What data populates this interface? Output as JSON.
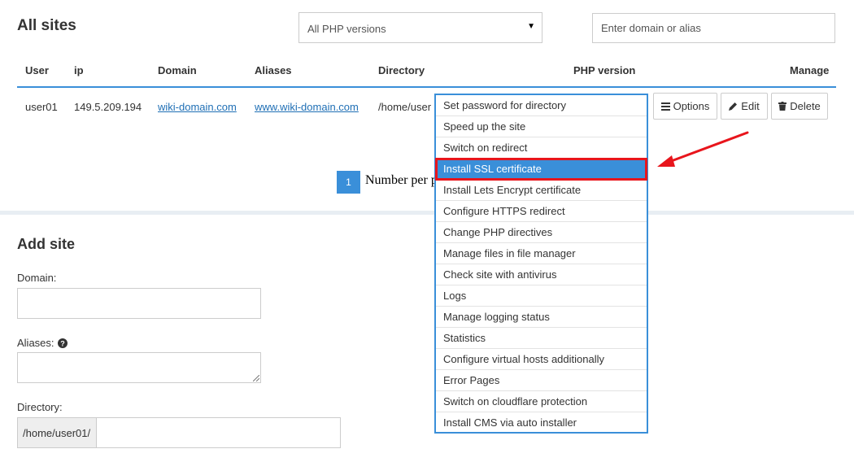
{
  "page": {
    "title": "All sites"
  },
  "filters": {
    "php_select_value": "All PHP versions",
    "search_placeholder": "Enter domain or alias"
  },
  "table": {
    "headers": [
      "User",
      "ip",
      "Domain",
      "Aliases",
      "Directory",
      "PHP version",
      "Manage"
    ],
    "row": {
      "user": "user01",
      "ip": "149.5.209.194",
      "domain": "wiki-domain.com",
      "alias": "www.wiki-domain.com",
      "directory": "/home/user"
    },
    "buttons": {
      "options": "Options",
      "edit": "Edit",
      "delete": "Delete"
    }
  },
  "pagination": {
    "current_page": "1",
    "per_page_label": "Number per p"
  },
  "options_menu": {
    "items": [
      "Set password for directory",
      "Speed up the site",
      "Switch on redirect",
      "Install SSL certificate",
      "Install Lets Encrypt certificate",
      "Configure HTTPS redirect",
      "Change PHP directives",
      "Manage files in file manager",
      "Check site with antivirus",
      "Logs",
      "Manage logging status",
      "Statistics",
      "Configure virtual hosts additionally",
      "Error Pages",
      "Switch on cloudflare protection",
      "Install CMS via auto installer"
    ],
    "highlighted_item": "Install SSL certificate"
  },
  "add_site": {
    "title": "Add site",
    "domain_label": "Domain:",
    "aliases_label": "Aliases:",
    "directory_label": "Directory:",
    "directory_prefix": "/home/user01/"
  },
  "colors": {
    "accent": "#3a8fd9",
    "annotation": "#e8151c"
  },
  "icons": [
    "caret-down-icon",
    "menu-lines-icon",
    "pencil-icon",
    "trash-icon",
    "help-circle-icon",
    "annotation-arrow"
  ]
}
